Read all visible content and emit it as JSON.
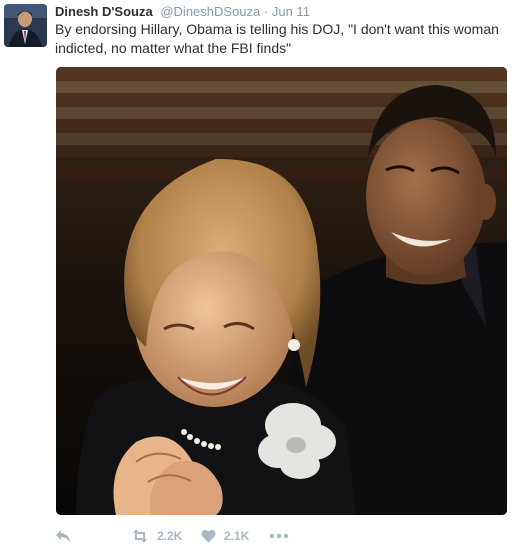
{
  "tweet": {
    "author_name": "Dinesh D'Souza",
    "handle": "@DineshDSouza",
    "separator": "·",
    "time": "Jun 11",
    "text": "By endorsing Hillary, Obama is telling his DOJ, \"I don't want this woman indicted, no matter what the FBI finds\""
  },
  "actions": {
    "retweet_count": "2.2K",
    "like_count": "2.1K"
  },
  "icons": {
    "reply": "reply-icon",
    "retweet": "retweet-icon",
    "like": "heart-icon",
    "more": "more-icon"
  },
  "colors": {
    "text": "#292f33",
    "secondary": "#8899a6",
    "action_gray": "#aab8c2"
  }
}
